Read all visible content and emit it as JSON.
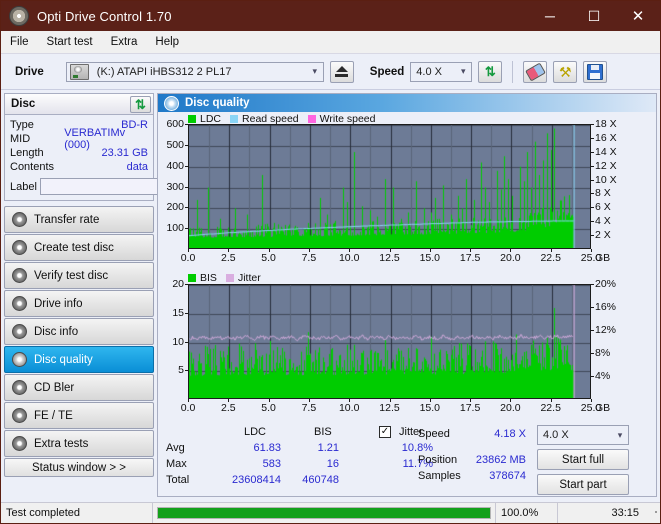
{
  "window": {
    "title": "Opti Drive Control 1.70",
    "icon": "disc-icon",
    "minimize": "─",
    "maximize": "☐",
    "close": "✕",
    "titlebar_color": "#5b2118"
  },
  "menu": {
    "items": [
      "File",
      "Start test",
      "Extra",
      "Help"
    ]
  },
  "toolbar": {
    "drive_label": "Drive",
    "drive_value": "(K:)  ATAPI iHBS312  2 PL17",
    "eject_title": "Eject",
    "speed_label": "Speed",
    "speed_value": "4.0 X",
    "refresh_icon": "refresh-icon",
    "erase_icon": "eraser-icon",
    "tools_icon": "tools-icon",
    "save_icon": "save-icon"
  },
  "disc": {
    "header": "Disc",
    "refresh_icon": "refresh-icon",
    "rows": [
      {
        "key": "Type",
        "value": "BD-R"
      },
      {
        "key": "MID",
        "value": "VERBATIMv (000)"
      },
      {
        "key": "Length",
        "value": "23.31 GB"
      },
      {
        "key": "Contents",
        "value": "data"
      }
    ],
    "label_key": "Label",
    "label_value": "",
    "label_placeholder": "",
    "disc_button_icon": "disc-icon"
  },
  "sidebar": {
    "items": [
      {
        "label": "Transfer rate",
        "icon": "disc-icon",
        "active": false
      },
      {
        "label": "Create test disc",
        "icon": "disc-icon",
        "active": false
      },
      {
        "label": "Verify test disc",
        "icon": "disc-icon",
        "active": false
      },
      {
        "label": "Drive info",
        "icon": "disc-icon",
        "active": false
      },
      {
        "label": "Disc info",
        "icon": "disc-icon",
        "active": false
      },
      {
        "label": "Disc quality",
        "icon": "disc-icon",
        "active": true
      },
      {
        "label": "CD Bler",
        "icon": "disc-icon",
        "active": false
      },
      {
        "label": "FE / TE",
        "icon": "disc-icon",
        "active": false
      },
      {
        "label": "Extra tests",
        "icon": "disc-icon",
        "active": false
      }
    ],
    "status_window": "Status window > >"
  },
  "panel": {
    "title": "Disc quality",
    "icon": "disc-icon"
  },
  "stats": {
    "col_ldc": "LDC",
    "col_bis": "BIS",
    "jitter_label": "Jitter",
    "jitter_checked": true,
    "rows": [
      {
        "key": "Avg",
        "ldc": "61.83",
        "bis": "1.21",
        "jitter": "10.8%"
      },
      {
        "key": "Max",
        "ldc": "583",
        "bis": "16",
        "jitter": "11.7%"
      },
      {
        "key": "Total",
        "ldc": "23608414",
        "bis": "460748",
        "jitter": ""
      }
    ],
    "speed_label": "Speed",
    "speed_value": "4.18 X",
    "speed_select": "4.0 X",
    "position_label": "Position",
    "position_value": "23862 MB",
    "samples_label": "Samples",
    "samples_value": "378674",
    "start_full": "Start full",
    "start_part": "Start part"
  },
  "statusbar": {
    "message": "Test completed",
    "progress_pct": "100.0%",
    "progress_value": 100,
    "elapsed": "33:15"
  },
  "chart_data": [
    {
      "id": "ldc-chart",
      "type": "area",
      "title": "",
      "xlabel": "GB",
      "ylabel": "",
      "xlim": [
        0,
        25
      ],
      "ylim": [
        0,
        600
      ],
      "y2lim": [
        0,
        18
      ],
      "y2label": "X",
      "xticks": [
        "0.0",
        "2.5",
        "5.0",
        "7.5",
        "10.0",
        "12.5",
        "15.0",
        "17.5",
        "20.0",
        "22.5",
        "25.0"
      ],
      "yticks": [
        "100",
        "200",
        "300",
        "400",
        "500",
        "600"
      ],
      "y2ticks": [
        "2 X",
        "4 X",
        "6 X",
        "8 X",
        "10 X",
        "12 X",
        "14 X",
        "16 X",
        "18 X"
      ],
      "grid": true,
      "legend": [
        {
          "name": "LDC",
          "color": "#00cc00"
        },
        {
          "name": "Read speed",
          "color": "#8ad4f5"
        },
        {
          "name": "Write speed",
          "color": "#ff66e0"
        }
      ],
      "plot_bg": "#6d7b96",
      "data_end_gb": 23.86,
      "series": [
        {
          "name": "LDC",
          "color": "#00cc00",
          "kind": "spike-area",
          "baseline": [
            60,
            58,
            62,
            60,
            59,
            61,
            58,
            60,
            62,
            61,
            60,
            62,
            63,
            61,
            60,
            62,
            61,
            63,
            62,
            64,
            63,
            62,
            64,
            63,
            65,
            64,
            63,
            65,
            66,
            64,
            65,
            67,
            66,
            65,
            67,
            68,
            66,
            67,
            69,
            68,
            67,
            69,
            70,
            68,
            70,
            71,
            69,
            71,
            72,
            70,
            72,
            73,
            71,
            73,
            74,
            72,
            74,
            75,
            73,
            75,
            76,
            74,
            76,
            77,
            75,
            77,
            78,
            76,
            78,
            80,
            78,
            80,
            82,
            80,
            82,
            84,
            82,
            84,
            86,
            84,
            86,
            88,
            90,
            92,
            95,
            98,
            100,
            104,
            108,
            112,
            118,
            124,
            132,
            140,
            150,
            160
          ],
          "spikes": [
            [
              2,
              240
            ],
            [
              5,
              300
            ],
            [
              8,
              150
            ],
            [
              12,
              200
            ],
            [
              15,
              170
            ],
            [
              19,
              360
            ],
            [
              22,
              130
            ],
            [
              25,
              120
            ],
            [
              28,
              110
            ],
            [
              31,
              130
            ],
            [
              34,
              250
            ],
            [
              36,
              170
            ],
            [
              38,
              140
            ],
            [
              40,
              300
            ],
            [
              41,
              230
            ],
            [
              43,
              470
            ],
            [
              45,
              210
            ],
            [
              47,
              190
            ],
            [
              49,
              160
            ],
            [
              51,
              340
            ],
            [
              53,
              300
            ],
            [
              55,
              150
            ],
            [
              57,
              180
            ],
            [
              59,
              330
            ],
            [
              61,
              200
            ],
            [
              63,
              180
            ],
            [
              64,
              250
            ],
            [
              66,
              310
            ],
            [
              68,
              170
            ],
            [
              70,
              260
            ],
            [
              71,
              200
            ],
            [
              72,
              340
            ],
            [
              74,
              240
            ],
            [
              76,
              420
            ],
            [
              77,
              300
            ],
            [
              78,
              230
            ],
            [
              80,
              380
            ],
            [
              81,
              290
            ],
            [
              82,
              450
            ],
            [
              83,
              340
            ],
            [
              84,
              260
            ],
            [
              86,
              400
            ],
            [
              87,
              330
            ],
            [
              88,
              470
            ],
            [
              89,
              300
            ],
            [
              90,
              520
            ],
            [
              91,
              360
            ],
            [
              92,
              430
            ],
            [
              93,
              560
            ],
            [
              94,
              480
            ],
            [
              95,
              583
            ]
          ]
        },
        {
          "name": "Read speed",
          "color": "#8ad4f5",
          "kind": "step-line",
          "axis": "y2",
          "values": [
            2.05,
            2.1,
            2.15,
            2.2,
            2.25,
            2.3,
            2.3,
            2.35,
            2.4,
            2.45,
            2.5,
            2.5,
            2.55,
            2.6,
            2.6,
            2.65,
            2.7,
            2.7,
            2.75,
            2.8,
            2.8,
            2.85,
            2.9,
            2.9,
            2.95,
            3.0,
            3.0,
            3.05,
            3.05,
            3.1,
            3.1,
            3.15,
            3.15,
            3.2,
            3.2,
            3.25,
            3.25,
            3.3,
            3.3,
            3.35,
            3.35,
            3.4,
            3.4,
            3.45,
            3.45,
            3.5,
            3.5,
            3.5,
            3.55,
            3.55,
            3.6,
            3.6,
            3.6,
            3.65,
            3.65,
            3.7,
            3.7,
            3.7,
            3.75,
            3.75,
            3.8,
            3.8,
            3.8,
            3.85,
            3.85,
            3.9,
            3.9,
            3.9,
            3.95,
            3.95,
            4.0,
            4.0,
            4.0,
            4.0,
            4.05,
            4.05,
            4.05,
            4.05,
            4.05,
            4.1,
            4.1,
            4.1,
            4.1,
            4.1,
            4.1,
            4.15,
            4.15,
            4.15,
            4.15,
            4.15,
            4.18,
            4.18,
            4.18,
            4.18,
            4.18,
            4.18
          ]
        }
      ]
    },
    {
      "id": "bis-chart",
      "type": "area",
      "title": "",
      "xlabel": "GB",
      "ylabel": "",
      "xlim": [
        0,
        25
      ],
      "ylim": [
        0,
        20
      ],
      "y2lim": [
        0,
        20
      ],
      "y2label": "%",
      "xticks": [
        "0.0",
        "2.5",
        "5.0",
        "7.5",
        "10.0",
        "12.5",
        "15.0",
        "17.5",
        "20.0",
        "22.5",
        "25.0"
      ],
      "yticks": [
        "5",
        "10",
        "15",
        "20"
      ],
      "y2ticks": [
        "4%",
        "8%",
        "12%",
        "16%",
        "20%"
      ],
      "grid": true,
      "legend": [
        {
          "name": "BIS",
          "color": "#00cc00"
        },
        {
          "name": "Jitter",
          "color": "#d9aee0"
        }
      ],
      "plot_bg": "#6d7b96",
      "data_end_gb": 23.86,
      "series": [
        {
          "name": "BIS",
          "color": "#00cc00",
          "kind": "spike-area",
          "baseline": [
            4.2,
            4.0,
            4.4,
            4.1,
            4.5,
            4.2,
            4.6,
            4.3,
            4.1,
            4.5,
            4.2,
            4.6,
            4.3,
            4.7,
            4.2,
            4.4,
            4.6,
            4.3,
            4.5,
            4.2,
            4.7,
            4.4,
            4.2,
            4.6,
            4.3,
            4.5,
            4.8,
            4.4,
            4.2,
            4.6,
            4.9,
            4.5,
            4.3,
            4.7,
            4.4,
            4.6,
            4.2,
            4.8,
            4.5,
            4.3,
            4.7,
            4.4,
            4.9,
            4.5,
            4.2,
            4.6,
            4.8,
            4.4,
            4.6,
            4.3,
            4.9,
            4.5,
            4.7,
            4.3,
            4.6,
            4.9,
            4.4,
            4.7,
            4.5,
            4.8,
            4.6,
            4.3,
            4.9,
            4.5,
            4.7,
            5.0,
            4.6,
            4.8,
            4.4,
            4.7,
            5.0,
            4.6,
            4.9,
            4.5,
            4.8,
            5.1,
            4.7,
            4.9,
            4.6,
            5.0,
            4.8,
            5.1,
            4.7,
            5.0,
            4.9,
            5.2,
            4.8,
            5.1,
            5.0,
            5.3,
            4.9,
            5.2,
            5.1,
            5.4,
            5.0,
            5.2
          ],
          "spikes": [
            [
              1,
              7.2
            ],
            [
              3,
              6.4
            ],
            [
              5,
              8.0
            ],
            [
              7,
              6.0
            ],
            [
              9,
              7.4
            ],
            [
              11,
              6.6
            ],
            [
              13,
              9.8
            ],
            [
              15,
              7.0
            ],
            [
              17,
              6.2
            ],
            [
              19,
              7.8
            ],
            [
              21,
              6.8
            ],
            [
              23,
              9.2
            ],
            [
              25,
              7.2
            ],
            [
              27,
              6.4
            ],
            [
              29,
              8.4
            ],
            [
              31,
              11.8
            ],
            [
              33,
              7.0
            ],
            [
              35,
              6.6
            ],
            [
              37,
              8.8
            ],
            [
              39,
              7.4
            ],
            [
              41,
              6.8
            ],
            [
              43,
              9.6
            ],
            [
              45,
              7.6
            ],
            [
              47,
              6.4
            ],
            [
              49,
              8.2
            ],
            [
              51,
              10.4
            ],
            [
              53,
              7.0
            ],
            [
              55,
              8.6
            ],
            [
              57,
              6.6
            ],
            [
              59,
              9.0
            ],
            [
              61,
              7.4
            ],
            [
              63,
              11.0
            ],
            [
              65,
              8.0
            ],
            [
              67,
              6.8
            ],
            [
              69,
              9.4
            ],
            [
              71,
              7.2
            ],
            [
              73,
              8.8
            ],
            [
              75,
              6.6
            ],
            [
              77,
              10.2
            ],
            [
              79,
              7.8
            ],
            [
              81,
              9.0
            ],
            [
              83,
              7.0
            ],
            [
              85,
              11.4
            ],
            [
              87,
              8.2
            ],
            [
              89,
              9.6
            ],
            [
              91,
              7.4
            ],
            [
              93,
              10.8
            ],
            [
              95,
              16.0
            ]
          ]
        },
        {
          "name": "Jitter",
          "color": "#d9aee0",
          "kind": "noisy-line",
          "axis": "y2",
          "mean": 10.8,
          "values": [
            10.7,
            10.9,
            10.6,
            11.0,
            10.8,
            10.5,
            10.9,
            11.1,
            10.7,
            10.8,
            11.0,
            10.6,
            10.9,
            10.7,
            11.1,
            10.8,
            10.6,
            10.9,
            11.0,
            10.7,
            10.8,
            11.2,
            10.6,
            10.9,
            10.7,
            11.0,
            10.8,
            10.5,
            10.9,
            11.1,
            10.7,
            10.8,
            10.6,
            11.0,
            10.9,
            10.7,
            11.1,
            10.8,
            10.6,
            10.9,
            11.0,
            10.7,
            10.8,
            11.2,
            10.6,
            10.9,
            10.8,
            11.0,
            10.7,
            10.9,
            11.1,
            10.6,
            10.8,
            10.9,
            11.0,
            10.7,
            11.1,
            10.8,
            10.6,
            10.9,
            11.0,
            10.8,
            10.7,
            11.2,
            10.9,
            10.6,
            10.8,
            11.0,
            10.9,
            10.7,
            11.1,
            10.8,
            10.9,
            10.6,
            11.0,
            10.8,
            10.7,
            11.1,
            10.9,
            10.8,
            11.0,
            10.7,
            11.2,
            10.9,
            10.8,
            11.0,
            10.9,
            11.1,
            10.8,
            11.0,
            10.9,
            11.2,
            11.0,
            10.9,
            11.1,
            11.0
          ]
        }
      ]
    }
  ]
}
